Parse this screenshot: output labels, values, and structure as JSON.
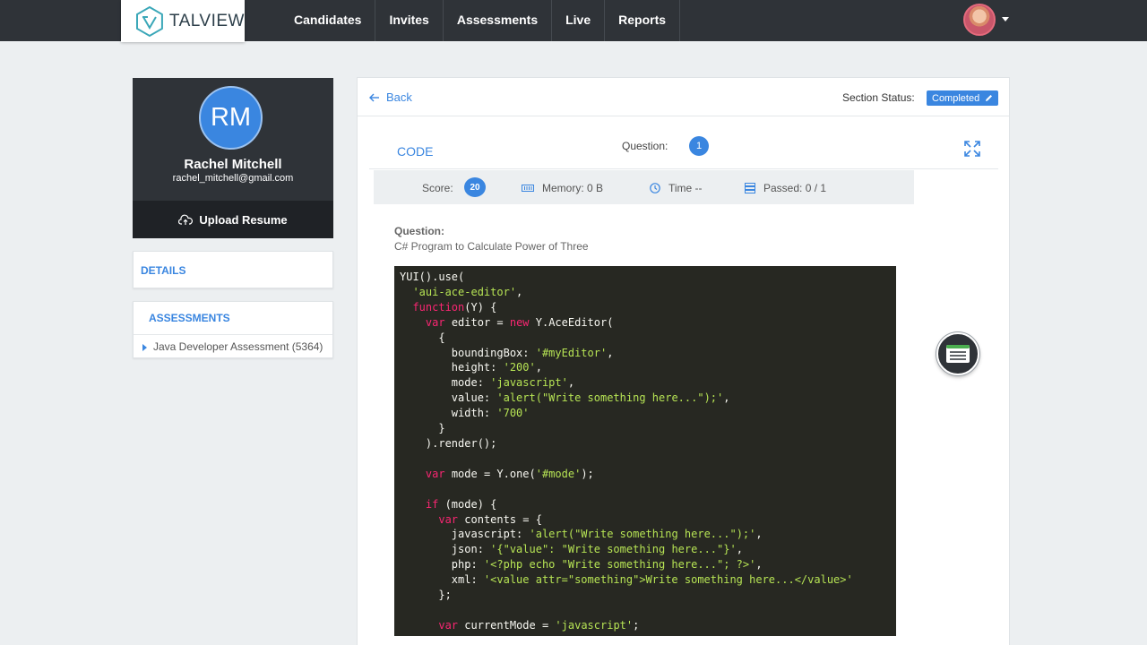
{
  "header": {
    "brand": "TALVIEW",
    "nav": [
      "Candidates",
      "Invites",
      "Assessments",
      "Live",
      "Reports"
    ]
  },
  "candidate": {
    "initials": "RM",
    "name": "Rachel Mitchell",
    "email": "rachel_mitchell@gmail.com",
    "upload_label": "Upload Resume"
  },
  "sidebar": {
    "details_label": "DETAILS",
    "assessments_label": "ASSESSMENTS",
    "assessment_item": "Java Developer Assessment (5364)"
  },
  "main": {
    "back_label": "Back",
    "status_label": "Section Status:",
    "status_value": "Completed",
    "section_title": "CODE",
    "question_label": "Question:",
    "question_number": "1",
    "score_label": "Score:",
    "score_value": "20",
    "memory": "Memory: 0 B",
    "time": "Time --",
    "passed": "Passed: 0 / 1",
    "question_heading": "Question:",
    "question_text": "C# Program to Calculate Power of Three"
  },
  "code": [
    [
      [
        "",
        "YUI().use("
      ]
    ],
    [
      [
        "",
        "  "
      ],
      [
        "st",
        "'aui-ace-editor'"
      ],
      [
        "",
        ","
      ]
    ],
    [
      [
        "",
        "  "
      ],
      [
        "kw",
        "function"
      ],
      [
        "",
        "(Y) {"
      ]
    ],
    [
      [
        "",
        "    "
      ],
      [
        "kw",
        "var"
      ],
      [
        "",
        " editor = "
      ],
      [
        "kw",
        "new"
      ],
      [
        "",
        " Y.AceEditor("
      ]
    ],
    [
      [
        "",
        "      {"
      ]
    ],
    [
      [
        "",
        "        boundingBox: "
      ],
      [
        "st",
        "'#myEditor'"
      ],
      [
        "",
        ","
      ]
    ],
    [
      [
        "",
        "        height: "
      ],
      [
        "st",
        "'200'"
      ],
      [
        "",
        ","
      ]
    ],
    [
      [
        "",
        "        mode: "
      ],
      [
        "st",
        "'javascript'"
      ],
      [
        "",
        ","
      ]
    ],
    [
      [
        "",
        "        value: "
      ],
      [
        "st",
        "'alert(\"Write something here...\");'"
      ],
      [
        "",
        ","
      ]
    ],
    [
      [
        "",
        "        width: "
      ],
      [
        "st",
        "'700'"
      ]
    ],
    [
      [
        "",
        "      }"
      ]
    ],
    [
      [
        "",
        "    ).render();"
      ]
    ],
    [
      [
        "",
        ""
      ]
    ],
    [
      [
        "",
        "    "
      ],
      [
        "kw",
        "var"
      ],
      [
        "",
        " mode = Y.one("
      ],
      [
        "st",
        "'#mode'"
      ],
      [
        "",
        ");"
      ]
    ],
    [
      [
        "",
        ""
      ]
    ],
    [
      [
        "",
        "    "
      ],
      [
        "kw",
        "if"
      ],
      [
        "",
        " (mode) {"
      ]
    ],
    [
      [
        "",
        "      "
      ],
      [
        "kw",
        "var"
      ],
      [
        "",
        " contents = {"
      ]
    ],
    [
      [
        "",
        "        javascript: "
      ],
      [
        "st",
        "'alert(\"Write something here...\");'"
      ],
      [
        "",
        ","
      ]
    ],
    [
      [
        "",
        "        json: "
      ],
      [
        "st",
        "'{\"value\": \"Write something here...\"}'"
      ],
      [
        "",
        ","
      ]
    ],
    [
      [
        "",
        "        php: "
      ],
      [
        "st",
        "'<?php echo \"Write something here...\"; ?>'"
      ],
      [
        "",
        ","
      ]
    ],
    [
      [
        "",
        "        xml: "
      ],
      [
        "st",
        "'<value attr=\"something\">Write something here...</value>'"
      ]
    ],
    [
      [
        "",
        "      };"
      ]
    ],
    [
      [
        "",
        ""
      ]
    ],
    [
      [
        "",
        "      "
      ],
      [
        "kw",
        "var"
      ],
      [
        "",
        " currentMode = "
      ],
      [
        "st",
        "'javascript'"
      ],
      [
        "",
        ";"
      ]
    ]
  ]
}
